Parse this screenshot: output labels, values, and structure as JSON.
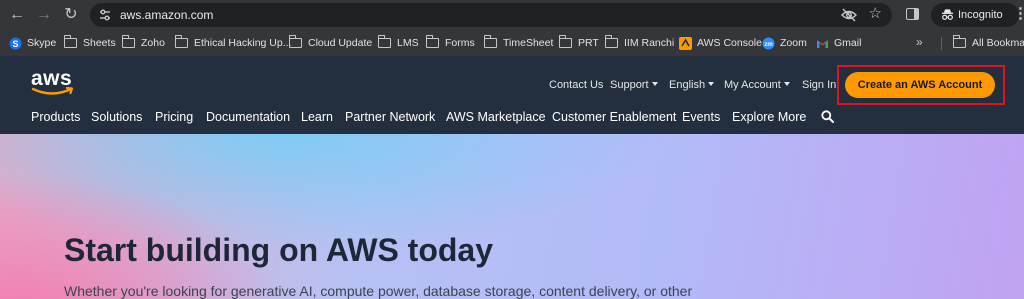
{
  "browser": {
    "url": "aws.amazon.com",
    "profile_label": "Incognito",
    "icons": {
      "back": "back-arrow-icon",
      "forward": "forward-arrow-icon",
      "reload": "reload-icon",
      "site_info": "tune-icon",
      "eye_off": "eye-off-icon",
      "star": "star-icon",
      "side_panel": "side-panel-icon",
      "incognito": "incognito-icon",
      "menu": "kebab-menu-icon"
    },
    "bookmarks": [
      {
        "label": "Skype",
        "icon": "skype-icon",
        "color": "#1a73e8"
      },
      {
        "label": "Sheets",
        "icon": "folder-icon"
      },
      {
        "label": "Zoho",
        "icon": "folder-icon"
      },
      {
        "label": "Ethical Hacking Up...",
        "icon": "folder-icon"
      },
      {
        "label": "Cloud Update",
        "icon": "folder-icon"
      },
      {
        "label": "LMS",
        "icon": "folder-icon"
      },
      {
        "label": "Forms",
        "icon": "folder-icon"
      },
      {
        "label": "TimeSheet",
        "icon": "folder-icon"
      },
      {
        "label": "PRT",
        "icon": "folder-icon"
      },
      {
        "label": "IIM Ranchi",
        "icon": "folder-icon"
      },
      {
        "label": "AWS Console",
        "icon": "aws-console-icon",
        "color": "#ff9900"
      },
      {
        "label": "Zoom",
        "icon": "zoom-icon",
        "color": "#2d8cff"
      },
      {
        "label": "Gmail",
        "icon": "gmail-icon",
        "color": "#ea4335"
      }
    ],
    "more_bookmarks": "»",
    "all_bookmarks": "All Bookmarks"
  },
  "aws": {
    "logo_text": "aws",
    "utility_nav": [
      "Contact Us",
      "Support",
      "English",
      "My Account",
      "Sign In"
    ],
    "cta_label": "Create an AWS Account",
    "main_nav": [
      "Products",
      "Solutions",
      "Pricing",
      "Documentation",
      "Learn",
      "Partner Network",
      "AWS Marketplace",
      "Customer Enablement",
      "Events",
      "Explore More"
    ],
    "colors": {
      "header_bg": "#232f3e",
      "cta_bg": "#ff9900",
      "highlight_box": "#e0141b"
    }
  },
  "hero": {
    "title": "Start building on AWS today",
    "subtitle": "Whether you're looking for generative AI, compute power, database storage, content delivery, or other"
  }
}
